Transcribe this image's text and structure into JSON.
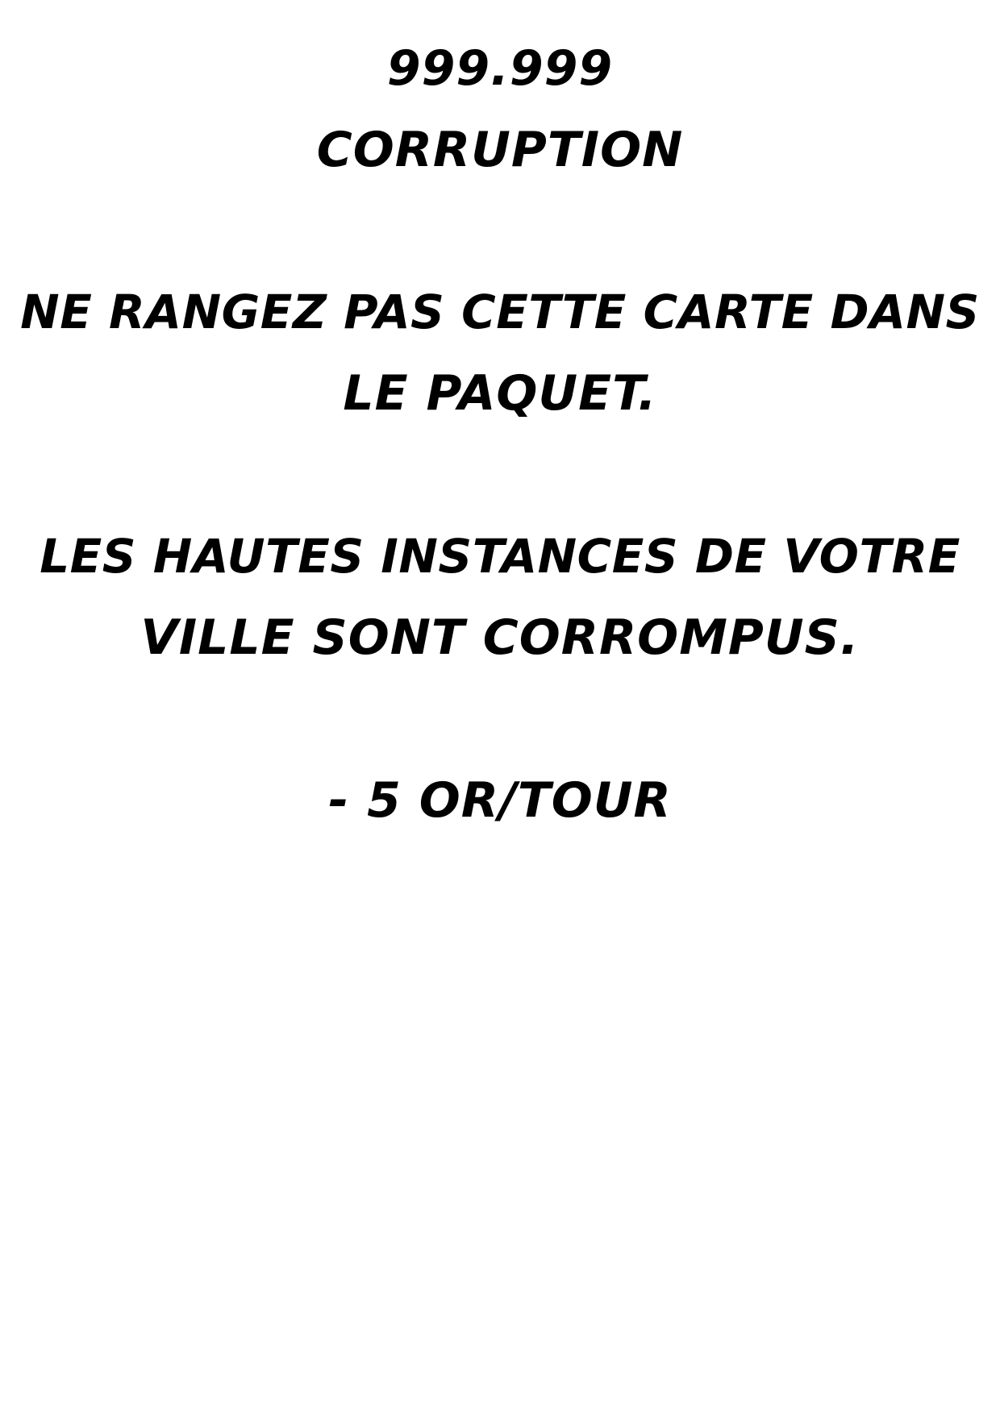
{
  "card": {
    "number": "999.999",
    "title": "CORRUPTION",
    "instruction_line1": "NE RANGEZ PAS CETTE CARTE DANS",
    "instruction_line2": "LE PAQUET.",
    "description_line1": "LES HAUTES INSTANCES DE VOTRE",
    "description_line2": "VILLE SONT CORROMPUS.",
    "effect": "- 5 OR/TOUR"
  },
  "colors": {
    "background": "#ffffff",
    "text": "#000000"
  }
}
